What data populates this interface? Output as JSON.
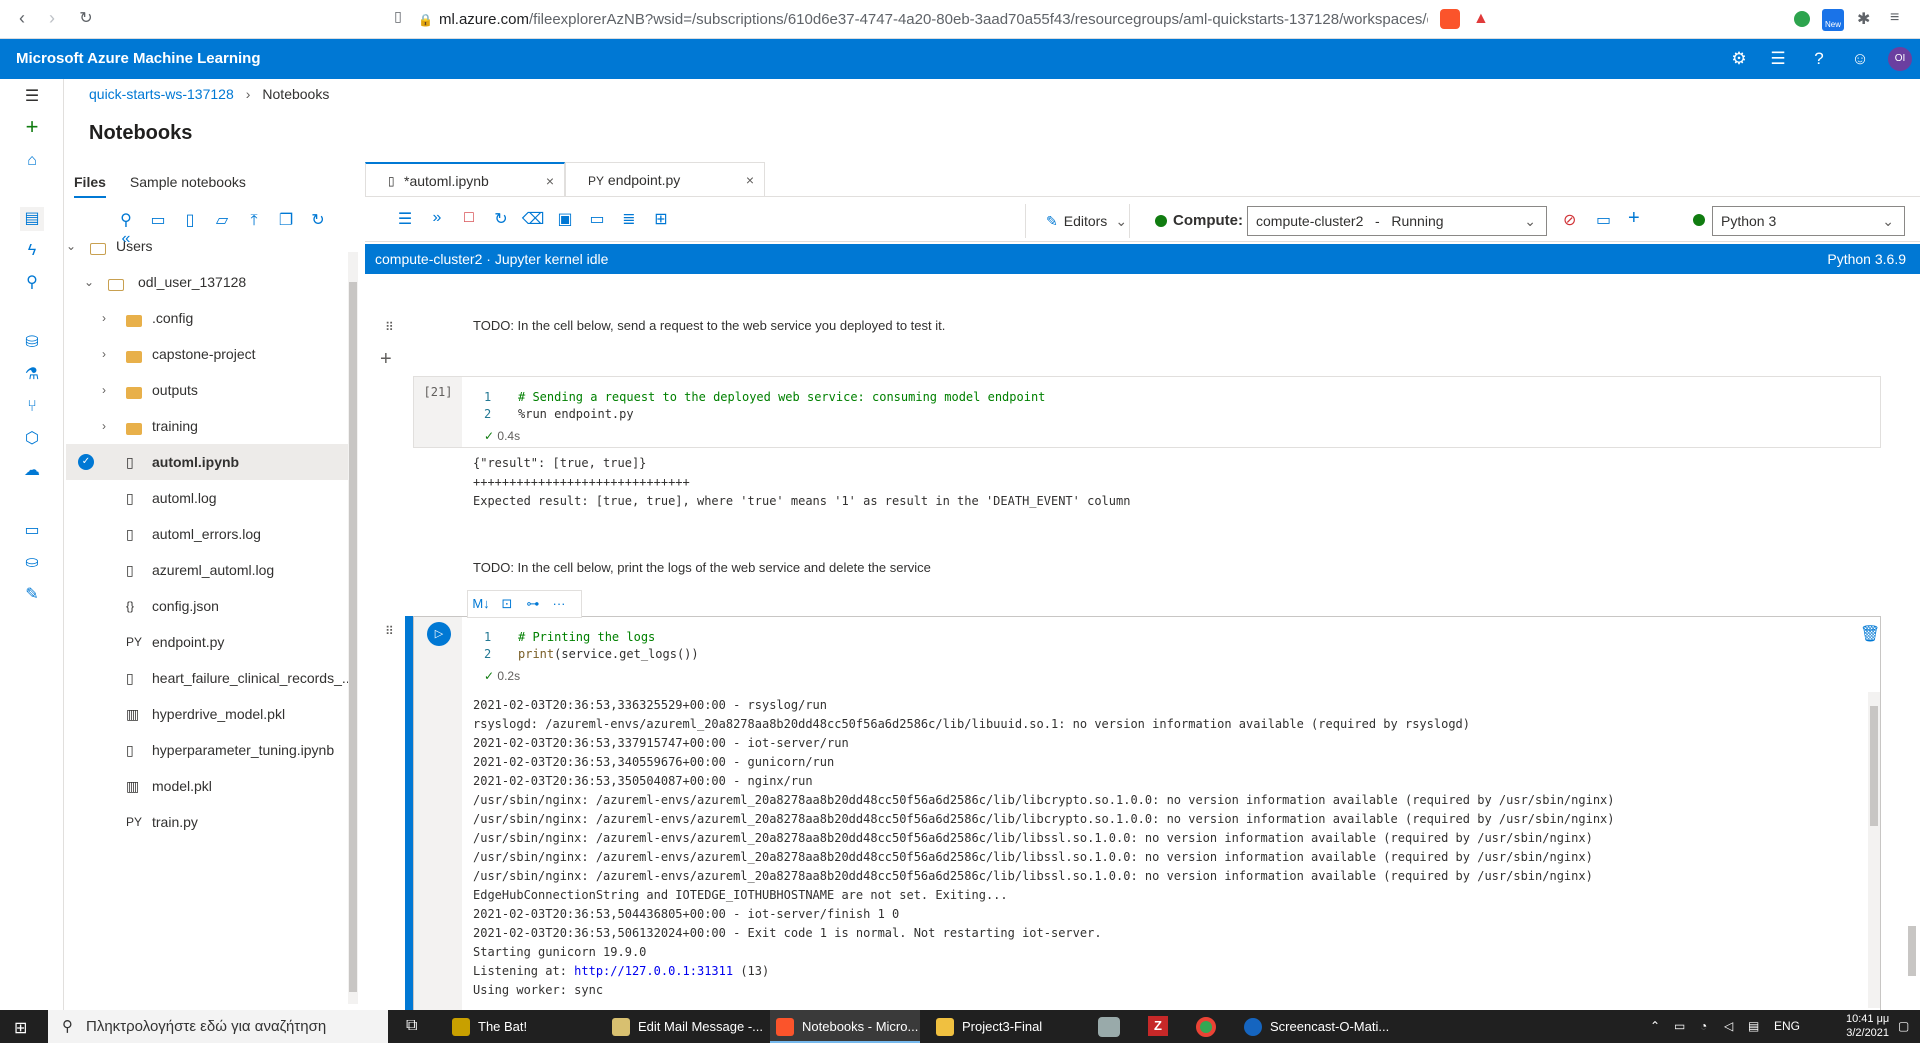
{
  "browser": {
    "url_host": "ml.azure.com",
    "url_rest": "/fileexplorerAzNB?wsid=/subscriptions/610d6e37-4747-4a20-80eb-3aad70a55f43/resourcegroups/aml-quickstarts-137128/workspaces/quick...",
    "back_icon": "arrow-left-icon",
    "forward_icon": "arrow-right-icon",
    "reload_icon": "reload-icon",
    "bookmark_icon": "bookmark-icon",
    "lock_icon": "lock-icon",
    "new_badge": "New"
  },
  "header": {
    "title": "Microsoft Azure Machine Learning",
    "avatar_initials": "OI",
    "accent_color": "#0078d4"
  },
  "breadcrumb": {
    "workspace": "quick-starts-ws-137128",
    "current": "Notebooks"
  },
  "page_title": "Notebooks",
  "file_panel": {
    "tabs": [
      "Files",
      "Sample notebooks"
    ],
    "active_tab": "Files",
    "tree": [
      {
        "label": "Users",
        "type": "folder-open",
        "level": 0
      },
      {
        "label": "odl_user_137128",
        "type": "folder-open",
        "level": 1
      },
      {
        "label": ".config",
        "type": "folder",
        "level": 2
      },
      {
        "label": "capstone-project",
        "type": "folder",
        "level": 2
      },
      {
        "label": "outputs",
        "type": "folder",
        "level": 2
      },
      {
        "label": "training",
        "type": "folder",
        "level": 2
      },
      {
        "label": "automl.ipynb",
        "type": "notebook",
        "level": 2,
        "selected": true
      },
      {
        "label": "automl.log",
        "type": "file",
        "level": 2
      },
      {
        "label": "automl_errors.log",
        "type": "file",
        "level": 2
      },
      {
        "label": "azureml_automl.log",
        "type": "file",
        "level": 2
      },
      {
        "label": "config.json",
        "type": "json",
        "level": 2
      },
      {
        "label": "endpoint.py",
        "type": "python",
        "level": 2
      },
      {
        "label": "heart_failure_clinical_records_...",
        "type": "file",
        "level": 2
      },
      {
        "label": "hyperdrive_model.pkl",
        "type": "binary",
        "level": 2
      },
      {
        "label": "hyperparameter_tuning.ipynb",
        "type": "notebook",
        "level": 2
      },
      {
        "label": "model.pkl",
        "type": "binary",
        "level": 2
      },
      {
        "label": "train.py",
        "type": "python",
        "level": 2
      }
    ],
    "py_badge": "PY",
    "json_badge": "{}"
  },
  "editor_tabs": [
    {
      "label": "*automl.ipynb",
      "active": true
    },
    {
      "label": "endpoint.py",
      "prefix": "PY",
      "active": false
    }
  ],
  "toolbar": {
    "editors_label": "Editors",
    "compute_label": "Compute:",
    "compute_value": "compute-cluster2   -   Running",
    "kernel_value": "Python 3"
  },
  "status_bar": {
    "left": "compute-cluster2 · Jupyter kernel idle",
    "right": "Python 3.6.9"
  },
  "notebook": {
    "md1": "TODO: In the cell below, send a request to the web service you deployed to test it.",
    "cell1": {
      "prompt": "[21]",
      "lines": [
        {
          "n": "1",
          "text": "# Sending a request to the deployed web service: consuming model endpoint"
        },
        {
          "n": "2",
          "text": "%run endpoint.py"
        }
      ],
      "time": "0.4s"
    },
    "out1": [
      "{\"result\": [true, true]}",
      "++++++++++++++++++++++++++++++",
      "Expected result: [true, true], where 'true' means '1' as result in the 'DEATH_EVENT' column"
    ],
    "md2": "TODO: In the cell below, print the logs of the web service and delete the service",
    "cell_toolbar": [
      "M↓",
      "⊡",
      "⊶",
      "···"
    ],
    "cell2": {
      "lines": [
        {
          "n": "1",
          "text": "# Printing the logs"
        },
        {
          "n": "2",
          "fn": "print",
          "text": "(service.get_logs())"
        }
      ],
      "time": "0.2s"
    },
    "out2": [
      "2021-02-03T20:36:53,336325529+00:00 - rsyslog/run",
      "rsyslogd: /azureml-envs/azureml_20a8278aa8b20dd48cc50f56a6d2586c/lib/libuuid.so.1: no version information available (required by rsyslogd)",
      "2021-02-03T20:36:53,337915747+00:00 - iot-server/run",
      "2021-02-03T20:36:53,340559676+00:00 - gunicorn/run",
      "2021-02-03T20:36:53,350504087+00:00 - nginx/run",
      "/usr/sbin/nginx: /azureml-envs/azureml_20a8278aa8b20dd48cc50f56a6d2586c/lib/libcrypto.so.1.0.0: no version information available (required by /usr/sbin/nginx)",
      "/usr/sbin/nginx: /azureml-envs/azureml_20a8278aa8b20dd48cc50f56a6d2586c/lib/libcrypto.so.1.0.0: no version information available (required by /usr/sbin/nginx)",
      "/usr/sbin/nginx: /azureml-envs/azureml_20a8278aa8b20dd48cc50f56a6d2586c/lib/libssl.so.1.0.0: no version information available (required by /usr/sbin/nginx)",
      "/usr/sbin/nginx: /azureml-envs/azureml_20a8278aa8b20dd48cc50f56a6d2586c/lib/libssl.so.1.0.0: no version information available (required by /usr/sbin/nginx)",
      "/usr/sbin/nginx: /azureml-envs/azureml_20a8278aa8b20dd48cc50f56a6d2586c/lib/libssl.so.1.0.0: no version information available (required by /usr/sbin/nginx)",
      "EdgeHubConnectionString and IOTEDGE_IOTHUBHOSTNAME are not set. Exiting...",
      "2021-02-03T20:36:53,504436805+00:00 - iot-server/finish 1 0",
      "2021-02-03T20:36:53,506132024+00:00 - Exit code 1 is normal. Not restarting iot-server.",
      "Starting gunicorn 19.9.0"
    ],
    "out2_listen_prefix": "Listening at: ",
    "out2_listen_link": "http://127.0.0.1:31311",
    "out2_listen_suffix": " (13)",
    "out2_last": "Using worker: sync"
  },
  "taskbar": {
    "search_placeholder": "Πληκτρολογήστε εδώ για αναζήτηση",
    "apps": [
      {
        "label": "The Bat!",
        "color": "#c8a000"
      },
      {
        "label": "Edit Mail Message -...",
        "color": "#d8c070"
      },
      {
        "label": "Notebooks - Micro...",
        "color": "#fb542b",
        "active": true
      },
      {
        "label": "Project3-Final",
        "color": "#f0c040"
      }
    ],
    "screencast": "Screencast-O-Mati...",
    "lang": "ENG",
    "time": "10:41 μμ",
    "date": "3/2/2021"
  }
}
